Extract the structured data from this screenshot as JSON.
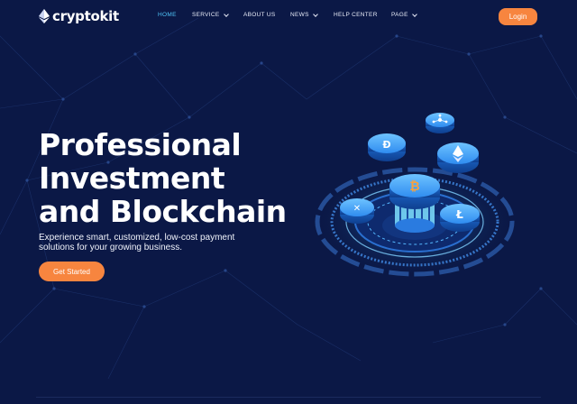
{
  "brand": {
    "name": "cryptokit"
  },
  "nav": {
    "items": [
      {
        "label": "HOME",
        "active": true,
        "dropdown": false
      },
      {
        "label": "SERVICE",
        "active": false,
        "dropdown": true
      },
      {
        "label": "ABOUT US",
        "active": false,
        "dropdown": false
      },
      {
        "label": "NEWS",
        "active": false,
        "dropdown": true
      },
      {
        "label": "HELP CENTER",
        "active": false,
        "dropdown": false
      },
      {
        "label": "PAGE",
        "active": false,
        "dropdown": true
      }
    ],
    "login_label": "Login"
  },
  "hero": {
    "title_lines": [
      "Professional",
      "Investment",
      "and Blockchain"
    ],
    "subtitle_lines": [
      "Experience smart, customized, low-cost payment",
      "solutions for your growing business."
    ],
    "cta_label": "Get Started"
  },
  "illustration": {
    "icons": [
      "bitcoin-coin-icon",
      "ripple-coin-icon",
      "dash-coin-icon",
      "network-coin-icon",
      "ethereum-coin-icon",
      "litecoin-coin-icon",
      "crypto-platform-icon"
    ]
  },
  "colors": {
    "background": "#0b1846",
    "accent": "#f7853f",
    "active_nav": "#4fc3f7",
    "coin_blue": "#2f8cf0"
  }
}
